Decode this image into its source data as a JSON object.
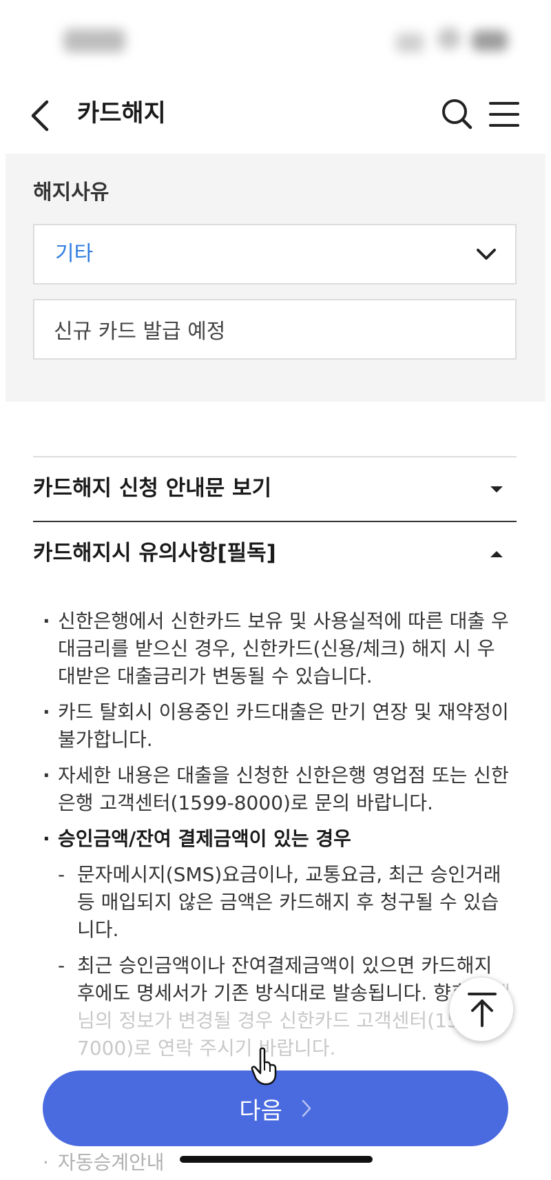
{
  "header": {
    "title": "카드해지"
  },
  "reason": {
    "label": "해지사유",
    "selected": "기타",
    "detail_value": "신규 카드 발급 예정"
  },
  "accordions": [
    {
      "title": "카드해지 신청 안내문 보기",
      "state": "collapsed"
    },
    {
      "title": "카드해지시 유의사항[필독]",
      "state": "expanded"
    }
  ],
  "notice": {
    "item1": "신한은행에서 신한카드 보유 및 사용실적에 따른 대출 우대금리를 받으신 경우, 신한카드(신용/체크) 해지 시 우대받은 대출금리가 변동될 수 있습니다.",
    "item2": "카드 탈회시 이용중인 카드대출은 만기 연장 및 재약정이 불가합니다.",
    "item3": "자세한 내용은 대출을 신청한 신한은행 영업점 또는 신한은행 고객센터(1599-8000)로 문의 바랍니다.",
    "item4": "승인금액/잔여 결제금액이 있는 경우",
    "sub1": "문자메시지(SMS)요금이나, 교통요금, 최근 승인거래 등 매입되지 않은 금액은 카드해지 후 청구될 수 있습니다.",
    "sub2_visible": "최근 승인금액이나 잔여결제금액이 있으면 카드해지 후에도 명세서가 기존 방식대로 발송됩니다. 향후",
    "sub2_faded": "고객님의 정보가 변경될 경우 신한카드 고객센터(1544-7000)로 연락 주시기 바랍니다.",
    "item5": "자동승계안내"
  },
  "next_button": {
    "label": "다음"
  },
  "colors": {
    "accent": "#4a6ae0",
    "selected_text": "#2f7de1",
    "panel_bg": "#f4f4f4"
  }
}
